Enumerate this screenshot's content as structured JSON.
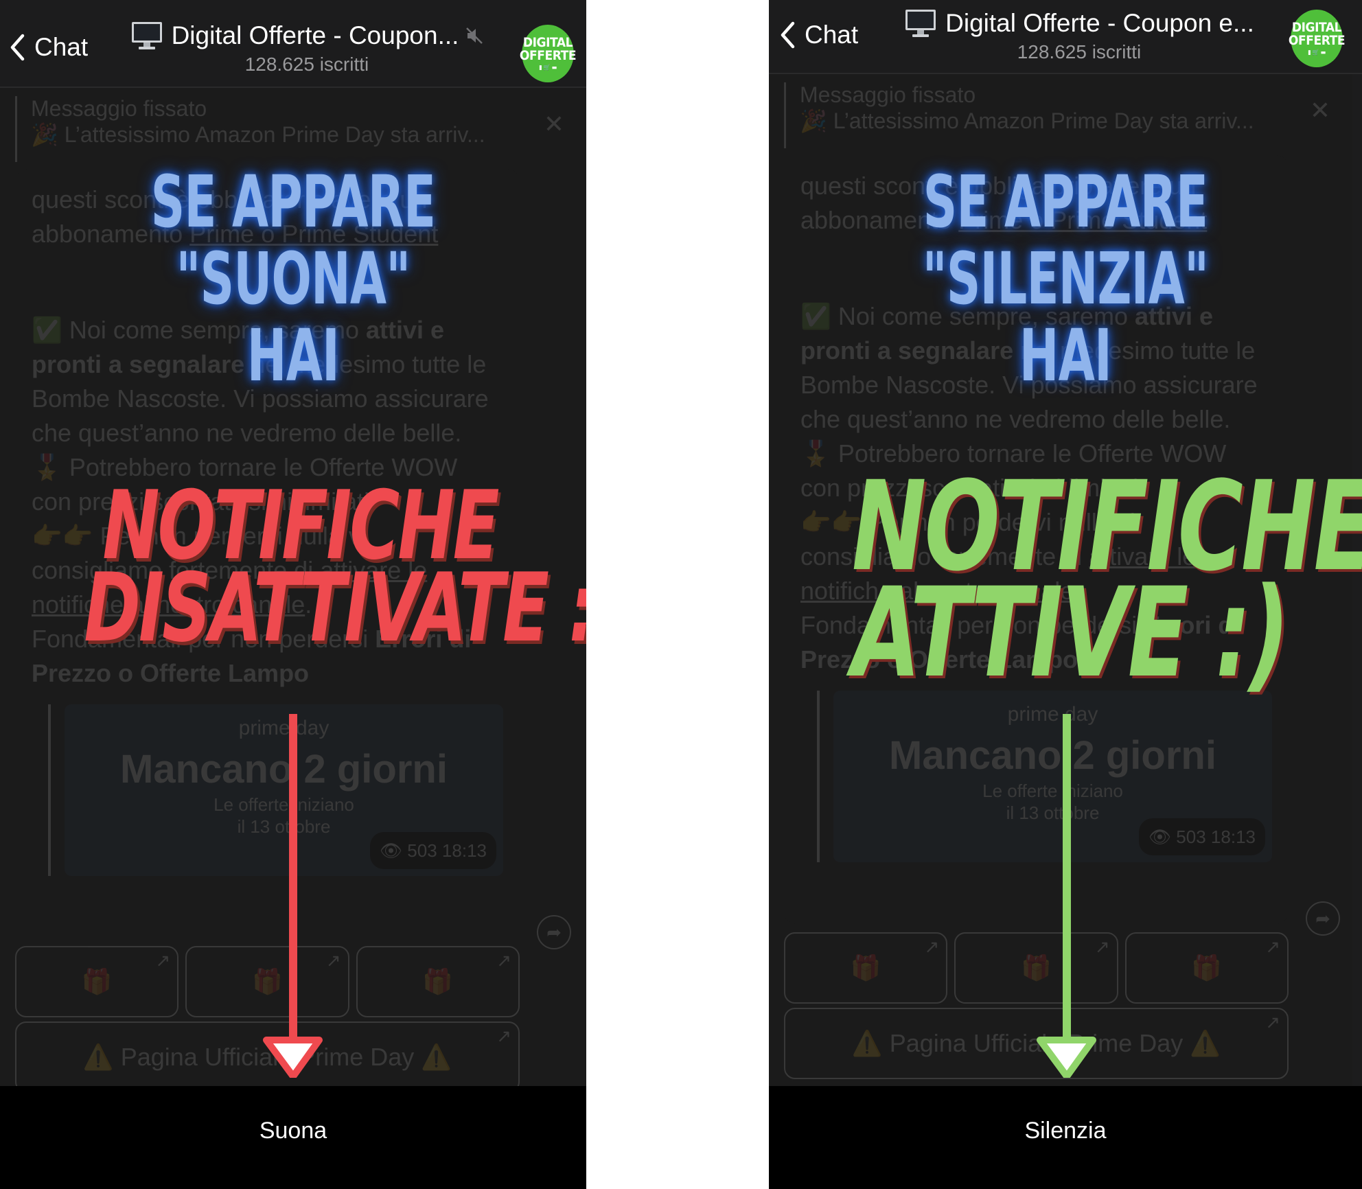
{
  "panels": [
    {
      "id": "left",
      "header": {
        "back_label": "Chat",
        "title": "Digital Offerte - Coupon...",
        "subtitle": "128.625 iscritti",
        "muted": true,
        "avatar": {
          "line1": "DIGITAL",
          "line2": "OFFERTE"
        }
      },
      "pinned": {
        "label": "Messaggio fissato",
        "text": "🎉 L’attesissimo Amazon Prime Day sta arriv..."
      },
      "message": {
        "line1": "questi sconti è obbligatorio avere un",
        "line2_plain": "abbonamento ",
        "line2_link": "Prime o Prime Student",
        "para2_emoji": "✅",
        "para2_a": " Noi come sempre, saremo ",
        "para2_bold1": "attivi e pronti a segnalare",
        "para2_b": " nel medesimo tutte le Bombe Nascoste. Vi possiamo assicurare che quest’anno ne vedremo delle belle.",
        "para3": "🎖️ Potrebbero tornare le Offerte WOW con prezzi scontatissimi limitati",
        "para4_a": "👉👉 Per non perdervi nulla vi consigliamo fortemente di ",
        "para4_link": "attivare le notifiche al nostro canale",
        "para4_b": ".",
        "para5_a": "Fondamentali per non perdersi ",
        "para5_bold": "Errori di Prezzo o Offerte Lampo"
      },
      "promo": {
        "brand": "prime day",
        "headline": "Mancano 2 giorni",
        "sub1": "Le offerte iniziano",
        "sub2": "il 13 ottobre",
        "views": "503",
        "time": "18:13"
      },
      "buttons": [
        "🎁",
        "🎁",
        "🎁"
      ],
      "wide_button": "⚠️ Pagina Ufficiale Prime Day ⚠️",
      "bottom_action": "Suona",
      "overlay": {
        "line1": "SE APPARE",
        "line2": "\"SUONA\"",
        "line3": "HAI",
        "status1": "NOTIFICHE",
        "status2": "DISATTIVATE :(",
        "status_color": "#ef4a4f"
      }
    },
    {
      "id": "right",
      "header": {
        "back_label": "Chat",
        "title": "Digital Offerte - Coupon e...",
        "subtitle": "128.625 iscritti",
        "muted": false,
        "avatar": {
          "line1": "DIGITAL",
          "line2": "OFFERTE"
        }
      },
      "pinned": {
        "label": "Messaggio fissato",
        "text": "🎉 L’attesissimo Amazon Prime Day sta arriv..."
      },
      "message": {
        "line1": "questi sconti è obbligatorio avere un",
        "line2_plain": "abbonamento ",
        "line2_link": "Prime o Prime Student",
        "para2_emoji": "✅",
        "para2_a": " Noi come sempre, saremo ",
        "para2_bold1": "attivi e pronti a segnalare",
        "para2_b": " nel medesimo tutte le Bombe Nascoste. Vi possiamo assicurare che quest’anno ne vedremo delle belle.",
        "para3": "🎖️ Potrebbero tornare le Offerte WOW con prezzi scontatissimi limitati",
        "para4_a": "👉👉 Per non perdervi nulla vi consigliamo fortemente di ",
        "para4_link": "attivare le notifiche al nostro canale",
        "para4_b": ".",
        "para5_a": "Fondamentali per non perdersi ",
        "para5_bold": "Errori di Prezzo o Offerte Lampo"
      },
      "promo": {
        "brand": "prime day",
        "headline": "Mancano 2 giorni",
        "sub1": "Le offerte iniziano",
        "sub2": "il 13 ottobre",
        "views": "503",
        "time": "18:13"
      },
      "buttons": [
        "🎁",
        "🎁",
        "🎁"
      ],
      "wide_button": "⚠️ Pagina Ufficiale Prime Day ⚠️",
      "bottom_action": "Silenzia",
      "overlay": {
        "line1": "SE APPARE",
        "line2": "\"SILENZIA\"",
        "line3": "HAI",
        "status1": "NOTIFICHE",
        "status2": "ATTIVE :)",
        "status_color": "#90d56a"
      }
    }
  ],
  "icons": {
    "back": "chevron-left-icon",
    "monitor": "desktop-computer-icon",
    "mute": "speaker-muted-icon",
    "close": "close-icon",
    "eye": "eye-icon",
    "share": "share-arrow-icon",
    "external": "arrow-up-right-icon"
  }
}
